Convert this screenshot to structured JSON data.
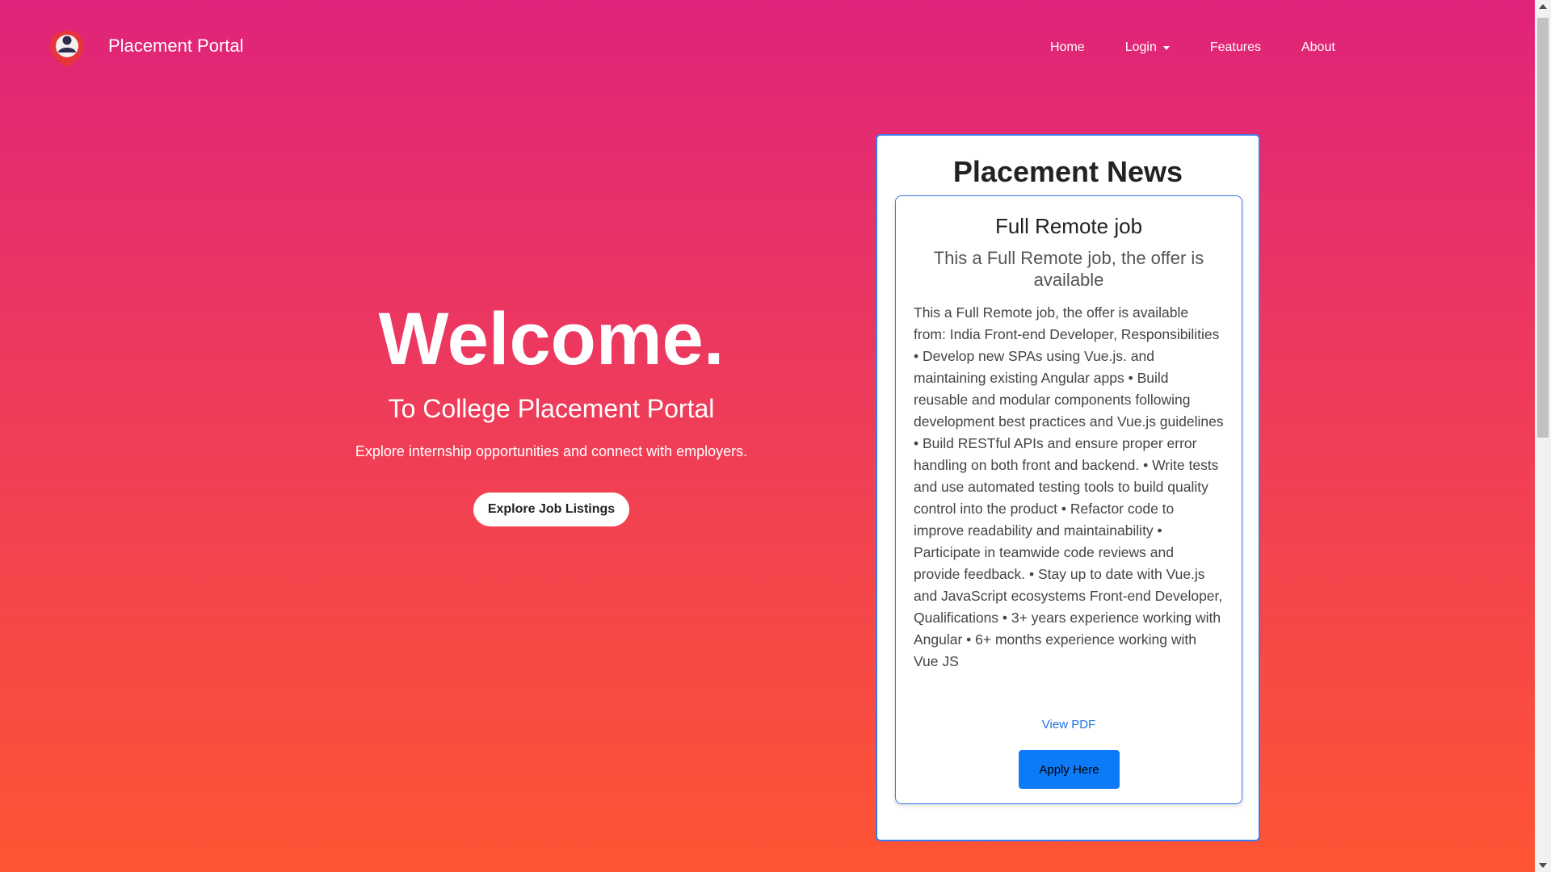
{
  "navbar": {
    "brand": "Placement Portal",
    "items": [
      {
        "label": "Home"
      },
      {
        "label": "Login",
        "dropdown": true
      },
      {
        "label": "Features"
      },
      {
        "label": "About"
      }
    ]
  },
  "hero": {
    "title": "Welcome.",
    "subtitle": "To College Placement Portal",
    "lead": "Explore internship opportunities and connect with employers.",
    "button": "Explore Job Listings"
  },
  "news": {
    "heading": "Placement News",
    "job": {
      "title": "Full Remote job",
      "subtitle": "This a Full Remote job, the offer is available",
      "description": "This a Full Remote job, the offer is available from: India Front-end Developer, Responsibilities • Develop new SPAs using Vue.js. and maintaining existing Angular apps • Build reusable and modular components following development best practices and Vue.js guidelines • Build RESTful APIs and ensure proper error handling on both front and backend. • Write tests and use automated testing tools to build quality control into the product • Refactor code to improve readability and maintainability • Participate in teamwide code reviews and provide feedback. • Stay up to date with Vue.js and JavaScript ecosystems Front-end Developer, Qualifications • 3+ years experience working with Angular • 6+ months experience working with Vue JS",
      "view_pdf": "View PDF",
      "apply": "Apply Here"
    }
  },
  "colors": {
    "gradient_top": "#e0237a",
    "gradient_bottom": "#ff5433",
    "card_border": "#3a7ae8",
    "apply_button": "#0d7bf7",
    "link": "#1a73e8"
  },
  "icons": {
    "logo": "user-location-pin-icon",
    "login_caret": "caret-down-icon"
  }
}
